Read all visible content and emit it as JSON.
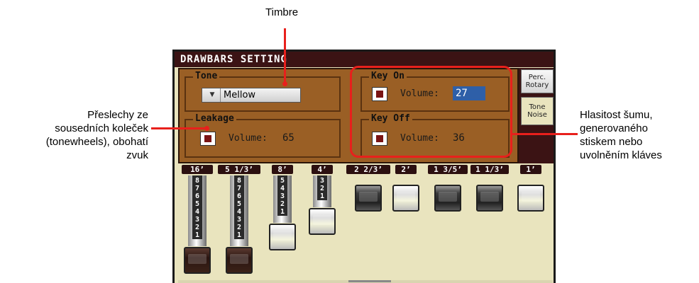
{
  "annotations": {
    "timbre": "Timbre",
    "leakage_lines": [
      "Přeslechy ze",
      "sousedních koleček",
      "(tonewheels), obohatí",
      "zvuk"
    ],
    "noise_lines": [
      "Hlasitost šumu,",
      "generovaného",
      "stiskem nebo",
      "uvolněním kláves"
    ]
  },
  "window": {
    "title": "DRAWBARS SETTING",
    "tone": {
      "label": "Tone",
      "selected": "Mellow"
    },
    "leakage": {
      "label": "Leakage",
      "volume_label": "Volume:",
      "volume": "65"
    },
    "key_on": {
      "label": "Key On",
      "volume_label": "Volume:",
      "volume": "27"
    },
    "key_off": {
      "label": "Key Off",
      "volume_label": "Volume:",
      "volume": "36"
    },
    "side_tabs": [
      {
        "line1": "Perc.",
        "line2": "Rotary"
      },
      {
        "line1": "Tone",
        "line2": "Noise"
      }
    ]
  },
  "drawbars": [
    {
      "footage": "16’",
      "level": 8,
      "color": "brown"
    },
    {
      "footage": "5 1/3’",
      "level": 8,
      "color": "brown"
    },
    {
      "footage": "8’",
      "level": 5,
      "color": "white"
    },
    {
      "footage": "4’",
      "level": 3,
      "color": "white"
    },
    {
      "footage": "2 2/3’",
      "level": 0,
      "color": "dark"
    },
    {
      "footage": "2’",
      "level": 0,
      "color": "white"
    },
    {
      "footage": "1 3/5’",
      "level": 0,
      "color": "dark"
    },
    {
      "footage": "1 1/3’",
      "level": 0,
      "color": "dark"
    },
    {
      "footage": "1’",
      "level": 0,
      "color": "white"
    }
  ],
  "colors": {
    "callout_red": "#e8201c",
    "title_bar": "#3b1314",
    "panel_brown": "#9a5f25",
    "value_highlight": "#2e5fa8"
  }
}
